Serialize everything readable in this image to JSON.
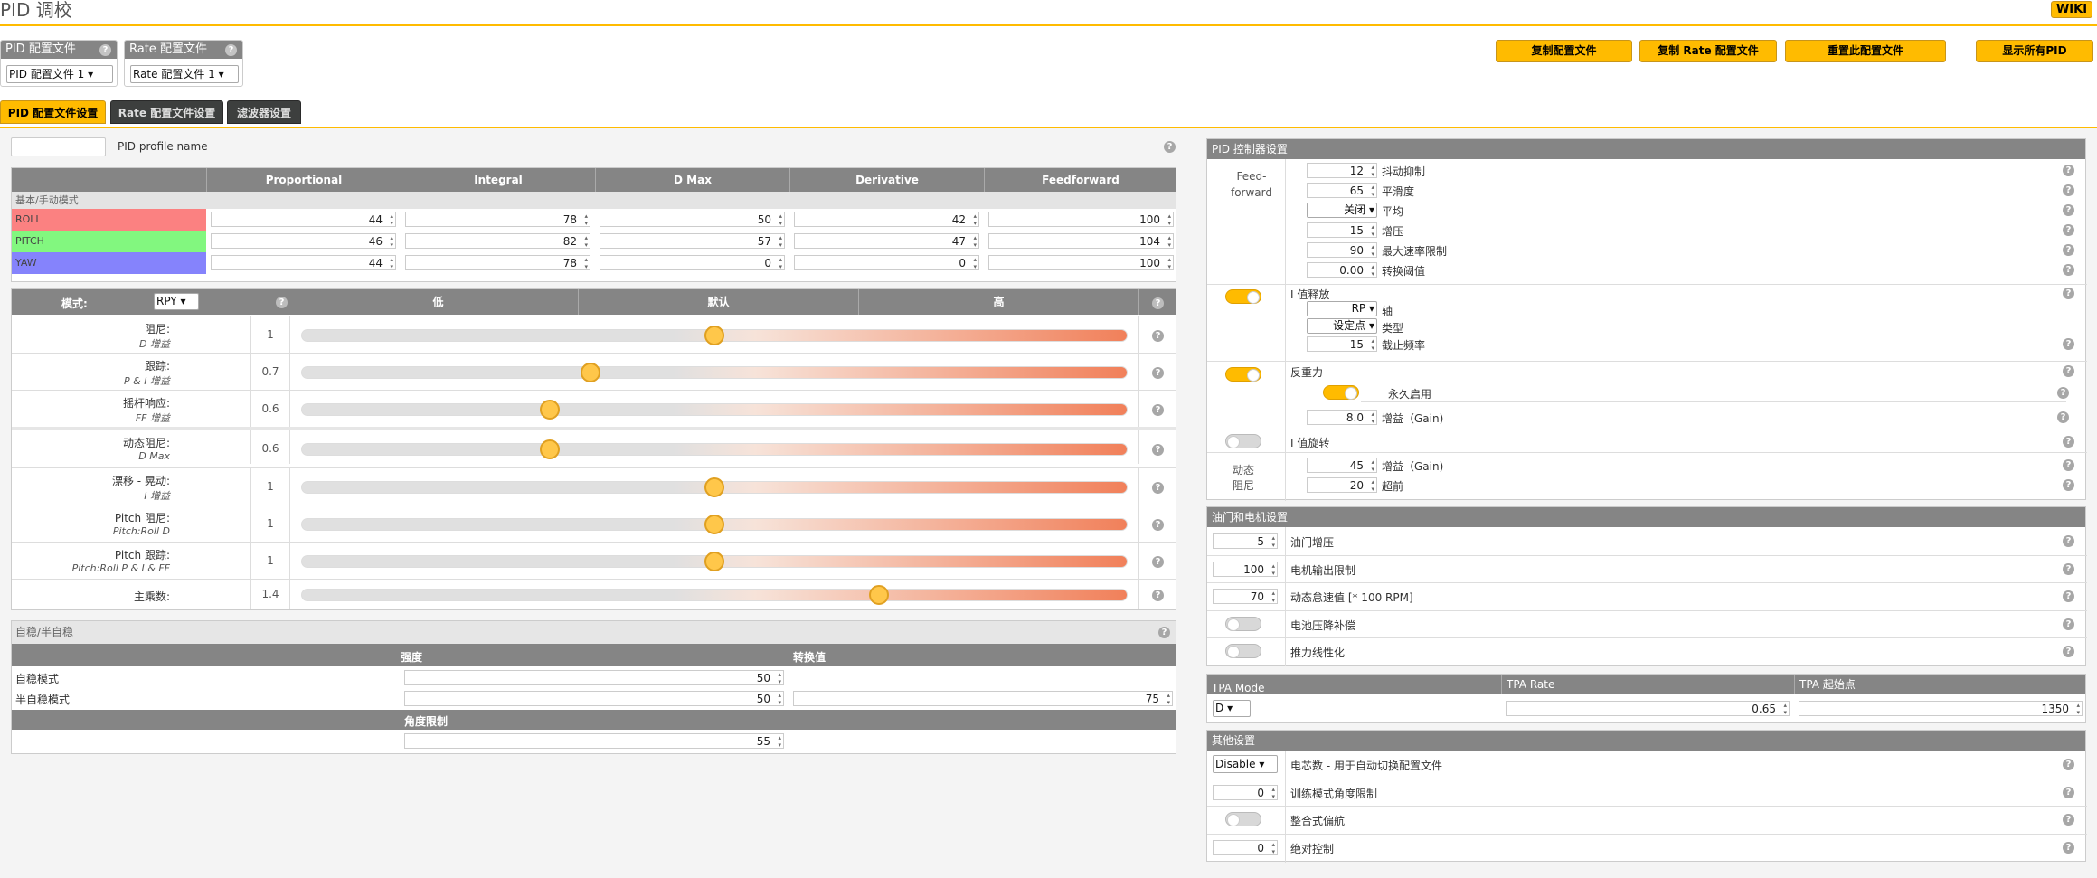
{
  "header": {
    "title": "PID 调校",
    "wiki": "WIKI"
  },
  "profile": {
    "pid_label": "PID 配置文件",
    "pid_value": "PID 配置文件 1",
    "rate_label": "Rate 配置文件",
    "rate_value": "Rate 配置文件 1"
  },
  "actions": [
    "复制配置文件",
    "复制 Rate 配置文件",
    "重置此配置文件",
    "显示所有PID"
  ],
  "tabs": [
    "PID 配置文件设置",
    "Rate 配置文件设置",
    "滤波器设置"
  ],
  "pid_name": {
    "value": "",
    "label": "PID profile name"
  },
  "pid_table": {
    "columns": [
      "Proportional",
      "Integral",
      "D Max",
      "Derivative",
      "Feedforward"
    ],
    "group": "基本/手动模式",
    "rows": [
      {
        "axis": "ROLL",
        "color": "#fb8181",
        "values": [
          "44",
          "78",
          "50",
          "42",
          "100"
        ]
      },
      {
        "axis": "PITCH",
        "color": "#82f77f",
        "values": [
          "46",
          "82",
          "57",
          "47",
          "104"
        ]
      },
      {
        "axis": "YAW",
        "color": "#8583fc",
        "values": [
          "44",
          "78",
          "0",
          "0",
          "100"
        ]
      }
    ]
  },
  "sliders": {
    "mode_label": "模式:",
    "mode_value": "RPY",
    "low": "低",
    "default": "默认",
    "high": "高",
    "rows": [
      {
        "name": "阻尼:",
        "sub": "D 增益",
        "value": "1",
        "pos": 0.5
      },
      {
        "name": "跟踪:",
        "sub": "P & I 增益",
        "value": "0.7",
        "pos": 0.35
      },
      {
        "name": "摇杆响应:",
        "sub": "FF 增益",
        "value": "0.6",
        "pos": 0.3
      },
      {
        "name": "动态阻尼:",
        "sub": "D Max",
        "value": "0.6",
        "pos": 0.3
      },
      {
        "name": "漂移 - 晃动:",
        "sub": "I 增益",
        "value": "1",
        "pos": 0.5
      },
      {
        "name": "Pitch 阻尼:",
        "sub": "Pitch:Roll D",
        "value": "1",
        "pos": 0.5
      },
      {
        "name": "Pitch 跟踪:",
        "sub": "Pitch:Roll P & I & FF",
        "value": "1",
        "pos": 0.5
      },
      {
        "name": "主乘数:",
        "sub": "",
        "value": "1.4",
        "pos": 0.7
      }
    ]
  },
  "angle": {
    "title": "自稳/半自稳",
    "col_strength": "强度",
    "col_transition": "转换值",
    "row1": "自稳模式",
    "row1_val": "50",
    "row2": "半自稳模式",
    "row2_val": "50",
    "row2_trans": "75",
    "limit_label": "角度限制",
    "limit_val": "55"
  },
  "pid_ctrl": {
    "title": "PID 控制器设置",
    "ff_label": "Feed-forward",
    "ff_rows": [
      {
        "value": "12",
        "label": "抖动抑制"
      },
      {
        "value": "65",
        "label": "平滑度"
      },
      {
        "value": "关闭",
        "label": "平均"
      },
      {
        "value": "15",
        "label": "增压"
      },
      {
        "value": "90",
        "label": "最大速率限制"
      },
      {
        "value": "0.00",
        "label": "转换阈值"
      }
    ],
    "irelax_label": "I 值释放",
    "irelax_axis": "RP",
    "irelax_axis_label": "轴",
    "irelax_type": "设定点",
    "irelax_type_label": "类型",
    "irelax_cutoff": "15",
    "irelax_cutoff_label": "截止频率",
    "antigrav_label": "反重力",
    "antigrav_perm": "永久启用",
    "antigrav_gain": "8.0",
    "antigrav_gain_label": "增益（Gain)",
    "irot_label": "I 值旋转",
    "dyn_label1": "动态",
    "dyn_label2": "阻尼",
    "dyn_gain": "45",
    "dyn_gain_label": "增益（Gain)",
    "dyn_adv": "20",
    "dyn_adv_label": "超前"
  },
  "motor": {
    "title": "油门和电机设置",
    "rows": [
      {
        "value": "5",
        "label": "油门增压"
      },
      {
        "value": "100",
        "label": "电机输出限制"
      },
      {
        "value": "70",
        "label": "动态怠速值 [* 100 RPM]"
      },
      {
        "value": "",
        "label": "电池压降补偿"
      },
      {
        "value": "",
        "label": "推力线性化"
      }
    ]
  },
  "tpa": {
    "mode_label": "TPA Mode",
    "rate_label": "TPA Rate",
    "bp_label": "TPA 起始点",
    "mode": "D",
    "rate": "0.65",
    "bp": "1350"
  },
  "misc": {
    "title": "其他设置",
    "rows": [
      {
        "value": "Disable",
        "label": "电芯数 - 用于自动切换配置文件"
      },
      {
        "value": "0",
        "label": "训练模式角度限制"
      },
      {
        "value": "",
        "label": "整合式偏航"
      },
      {
        "value": "0",
        "label": "绝对控制"
      }
    ]
  }
}
